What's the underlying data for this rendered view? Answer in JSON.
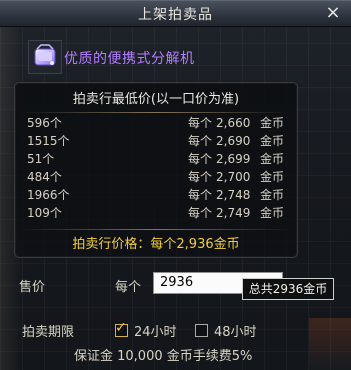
{
  "window": {
    "title": "上架拍卖品",
    "close_icon": "×"
  },
  "item": {
    "name": "优质的便携式分解机",
    "icon_name": "portable-disassembler-icon",
    "name_color": "#b37dff"
  },
  "price_panel": {
    "header": "拍卖行最低价(以一口价为准)",
    "rows": [
      {
        "qty": "596个",
        "each": "每个",
        "price": "2,660",
        "currency": "金币"
      },
      {
        "qty": "1515个",
        "each": "每个",
        "price": "2,690",
        "currency": "金币"
      },
      {
        "qty": "51个",
        "each": "每个",
        "price": "2,699",
        "currency": "金币"
      },
      {
        "qty": "484个",
        "each": "每个",
        "price": "2,700",
        "currency": "金币"
      },
      {
        "qty": "1966个",
        "each": "每个",
        "price": "2,748",
        "currency": "金币"
      },
      {
        "qty": "109个",
        "each": "每个",
        "price": "2,749",
        "currency": "金币"
      }
    ],
    "footer": "拍卖行价格：每个2,936金币",
    "footer_color": "#f3cf3a"
  },
  "pricing": {
    "label": "售价",
    "each_label": "每个",
    "input_value": "2936",
    "tooltip": "总共2936金币"
  },
  "period": {
    "label": "拍卖期限",
    "options": [
      {
        "label": "24小时",
        "checked": true
      },
      {
        "label": "48小时",
        "checked": false
      }
    ]
  },
  "deposit": "保证金 10,000 金币手续费5%"
}
